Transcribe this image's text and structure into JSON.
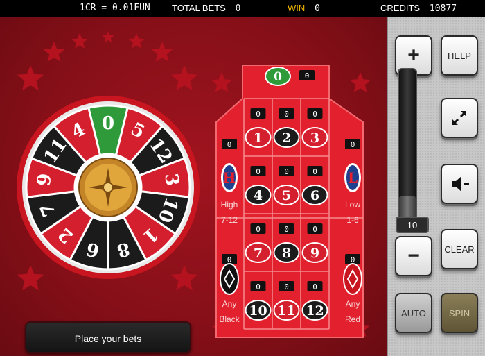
{
  "topbar": {
    "rate": "1CR = 0.01FUN",
    "total_bets_label": "TOTAL BETS",
    "total_bets_value": "0",
    "win_label": "WIN",
    "win_value": "0",
    "credits_label": "CREDITS",
    "credits_value": "10877"
  },
  "colors": {
    "background": "#850f18",
    "red_pocket": "#d4202e",
    "black_pocket": "#1b1b1b",
    "green_pocket": "#2e9a3a",
    "win_label": "#f2b600"
  },
  "wheel": {
    "pockets": [
      {
        "number": "0",
        "color": "green"
      },
      {
        "number": "5",
        "color": "red"
      },
      {
        "number": "12",
        "color": "black"
      },
      {
        "number": "3",
        "color": "red"
      },
      {
        "number": "10",
        "color": "black"
      },
      {
        "number": "1",
        "color": "red"
      },
      {
        "number": "8",
        "color": "black"
      },
      {
        "number": "6",
        "color": "black"
      },
      {
        "number": "2",
        "color": "red"
      },
      {
        "number": "7",
        "color": "black"
      },
      {
        "number": "9",
        "color": "red"
      },
      {
        "number": "11",
        "color": "black"
      },
      {
        "number": "4",
        "color": "red"
      }
    ],
    "hub_icon": "compass-rose-icon"
  },
  "table": {
    "zero": {
      "number": "0",
      "bet": "0"
    },
    "rows": [
      {
        "cells": [
          {
            "number": "1",
            "color": "red",
            "bet": "0"
          },
          {
            "number": "2",
            "color": "black",
            "bet": "0"
          },
          {
            "number": "3",
            "color": "red",
            "bet": "0"
          }
        ],
        "side_bet_left": "0",
        "side_bet_right": "0"
      },
      {
        "cells": [
          {
            "number": "4",
            "color": "black",
            "bet": "0"
          },
          {
            "number": "5",
            "color": "red",
            "bet": "0"
          },
          {
            "number": "6",
            "color": "black",
            "bet": "0"
          }
        ]
      },
      {
        "cells": [
          {
            "number": "7",
            "color": "red",
            "bet": "0"
          },
          {
            "number": "8",
            "color": "black",
            "bet": "0"
          },
          {
            "number": "9",
            "color": "red",
            "bet": "0"
          }
        ],
        "side_bet_left": "0",
        "side_bet_right": "0"
      },
      {
        "cells": [
          {
            "number": "10",
            "color": "black",
            "bet": "0"
          },
          {
            "number": "11",
            "color": "red",
            "bet": "0"
          },
          {
            "number": "12",
            "color": "black",
            "bet": "0"
          }
        ]
      }
    ],
    "high": {
      "letter": "H",
      "label1": "High",
      "label2": "7-12"
    },
    "low": {
      "letter": "L",
      "label1": "Low",
      "label2": "1-6"
    },
    "any_black": {
      "label1": "Any",
      "label2": "Black"
    },
    "any_red": {
      "label1": "Any",
      "label2": "Red"
    }
  },
  "status": {
    "message": "Place your bets"
  },
  "controls": {
    "plus": "+",
    "minus": "−",
    "help": "HELP",
    "clear": "CLEAR",
    "auto": "AUTO",
    "spin": "SPIN",
    "bet_value": "10",
    "bet_level": 0.2,
    "fullscreen_icon": "fullscreen-arrows-icon",
    "sound_icon": "speaker-icon"
  }
}
